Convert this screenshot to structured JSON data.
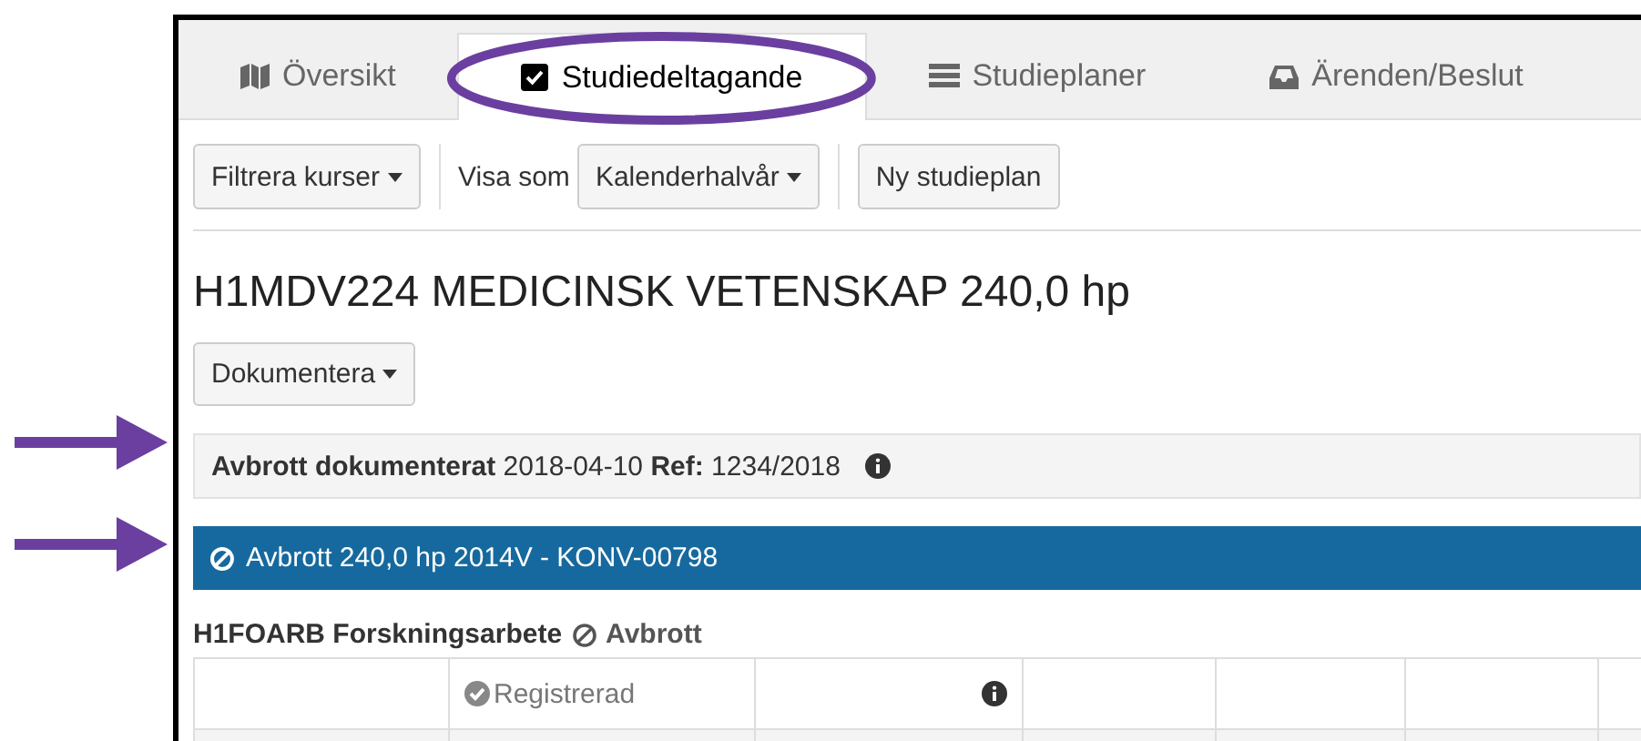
{
  "tabs": [
    {
      "label": "Översikt",
      "selected": false
    },
    {
      "label": "Studiedeltagande",
      "selected": true
    },
    {
      "label": "Studieplaner",
      "selected": false
    },
    {
      "label": "Ärenden/Beslut",
      "selected": false
    }
  ],
  "toolbar": {
    "filter_button": "Filtrera kurser",
    "view_label": "Visa som",
    "view_select": "Kalenderhalvår",
    "new_plan_button": "Ny studieplan"
  },
  "program_title": "H1MDV224 MEDICINSK VETENSKAP 240,0 hp",
  "document_button": "Dokumentera",
  "notice": "**Avbrott dokumenterat** 2018-04-10 **Ref:** 1234/2018",
  "status_bar": "Avbrott 240,0 hp 2014V - KONV-00798",
  "course": {
    "code": "H1FOARB Forskningsarbete",
    "status": "Avbrott"
  },
  "table": {
    "rows": [
      {
        "status": "Registrerad"
      }
    ]
  }
}
